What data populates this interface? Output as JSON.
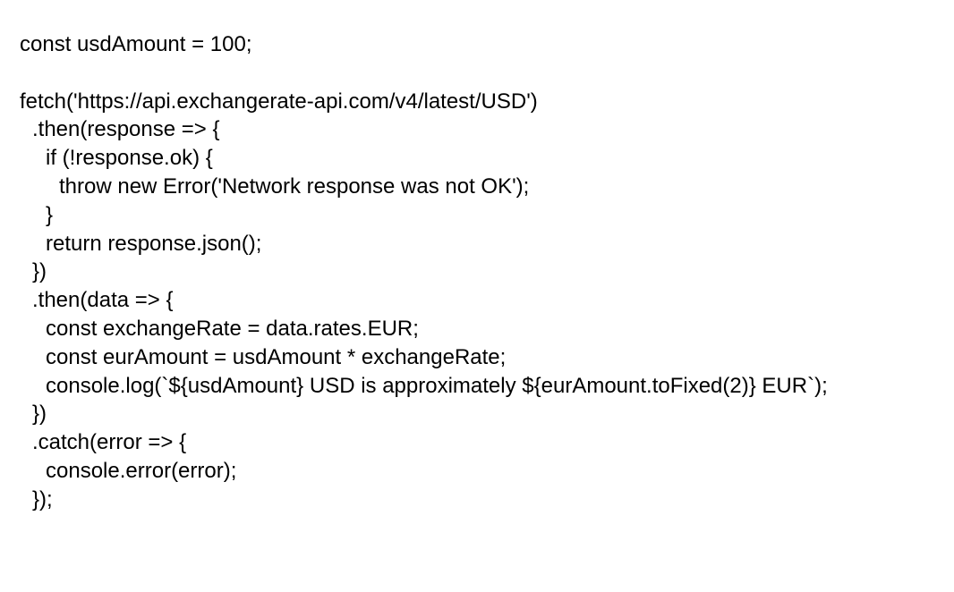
{
  "code": {
    "lines": [
      "const usdAmount = 100;",
      "",
      "fetch('https://api.exchangerate-api.com/v4/latest/USD')",
      ".then(response => {",
      "if (!response.ok) {",
      "throw new Error('Network response was not OK');",
      "}",
      "return response.json();",
      "})",
      ".then(data => {",
      "const exchangeRate = data.rates.EUR;",
      "const eurAmount = usdAmount * exchangeRate;",
      "console.log(`${usdAmount} USD is approximately ${eurAmount.toFixed(2)} EUR`);",
      "})",
      ".catch(error => {",
      "console.error(error);",
      "});"
    ]
  }
}
